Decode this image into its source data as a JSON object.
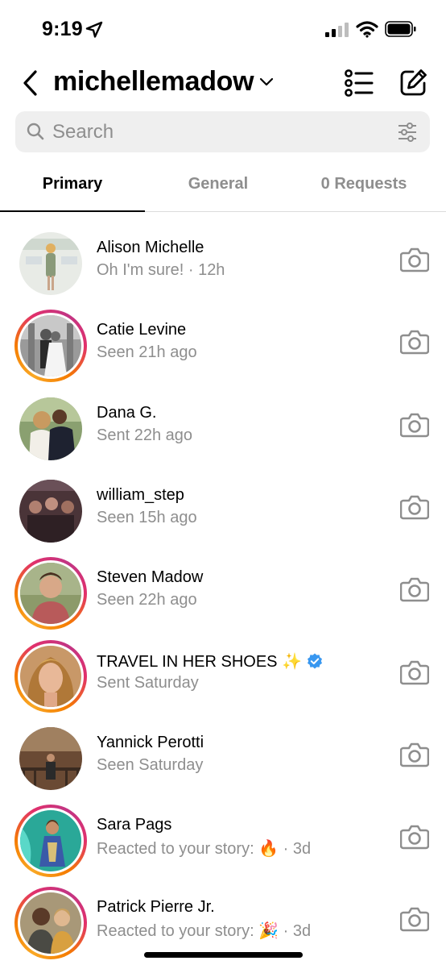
{
  "status_bar": {
    "time": "9:19",
    "icons": [
      "location-arrow-icon",
      "cell-signal-icon",
      "wifi-icon",
      "battery-icon"
    ]
  },
  "header": {
    "username": "michellemadow",
    "icons": [
      "back-chevron-icon",
      "chevron-down-icon",
      "notes-list-icon",
      "new-message-icon"
    ]
  },
  "search": {
    "placeholder": "Search",
    "value": ""
  },
  "tabs": [
    {
      "label": "Primary",
      "active": true
    },
    {
      "label": "General",
      "active": false
    },
    {
      "label": "0 Requests",
      "active": false
    }
  ],
  "colors": {
    "text_secondary": "#8e8e8e",
    "search_bg": "#efefef",
    "verified_blue": "#3897f0",
    "story_ring": [
      "#f9a825",
      "#e1306c",
      "#c13584"
    ]
  },
  "threads": [
    {
      "name": "Alison Michelle",
      "subtitle": "Oh I'm sure! · 12h",
      "story_ring": false
    },
    {
      "name": "Catie Levine",
      "subtitle": "Seen 21h ago",
      "story_ring": true
    },
    {
      "name": "Dana G.",
      "subtitle": "Sent 22h ago",
      "story_ring": false
    },
    {
      "name": "william_step",
      "subtitle": "Seen 15h ago",
      "story_ring": false
    },
    {
      "name": "Steven Madow",
      "subtitle": "Seen 22h ago",
      "story_ring": true
    },
    {
      "name": "TRAVEL IN HER SHOES ✨",
      "subtitle": "Sent Saturday",
      "story_ring": true,
      "verified": true
    },
    {
      "name": "Yannick Perotti",
      "subtitle": "Seen Saturday",
      "story_ring": false
    },
    {
      "name": "Sara Pags",
      "subtitle": "Reacted to your story: 🔥 · 3d",
      "story_ring": true
    },
    {
      "name": "Patrick Pierre Jr.",
      "subtitle": "Reacted to your story: 🎉 · 3d",
      "story_ring": true
    }
  ]
}
